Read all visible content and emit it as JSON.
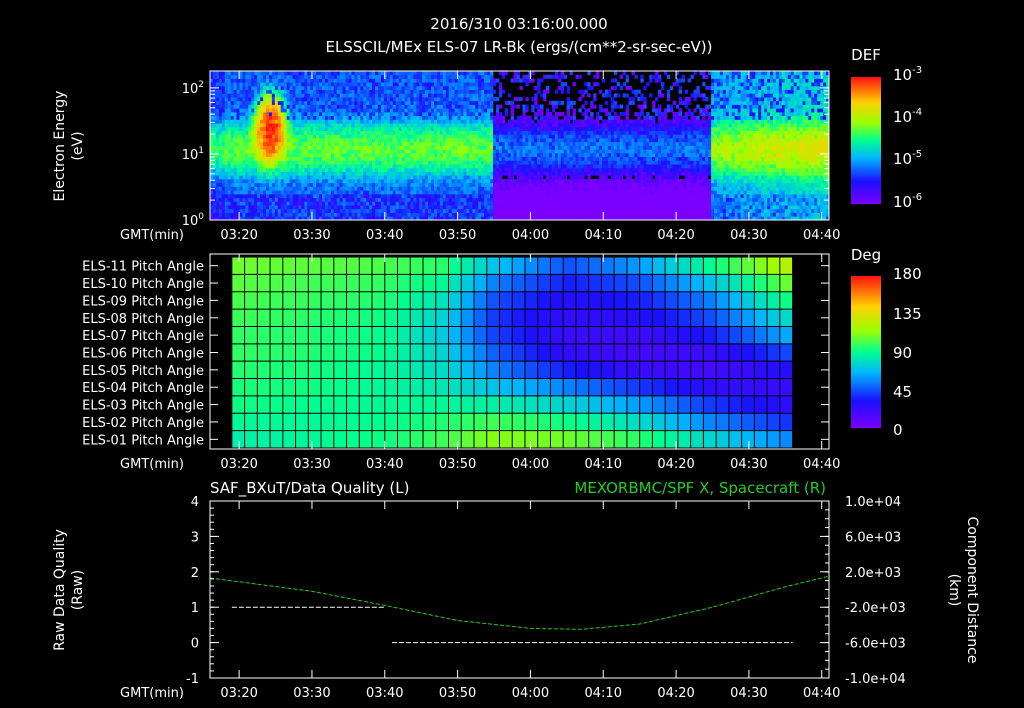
{
  "header": {
    "line1": "2016/310 03:16:00.000",
    "line2": "ELSSCIL/MEx ELS-07 LR-Bk  (ergs/(cm**2-sr-sec-eV))"
  },
  "time_axis": {
    "label": "GMT(min)",
    "ticks": [
      "03:20",
      "03:30",
      "03:40",
      "03:50",
      "04:00",
      "04:10",
      "04:20",
      "04:30",
      "04:40"
    ]
  },
  "chart_data": [
    {
      "type": "heatmap",
      "id": "electron-spectrogram",
      "title": "ELSSCIL/MEx ELS-07 LR-Bk  (ergs/(cm**2-sr-sec-eV))",
      "ylabel": "Electron Energy\n(eV)",
      "yscale": "log",
      "ylim": [
        1,
        180
      ],
      "y_ticks": [
        {
          "base": "10",
          "exp": "0",
          "value": 1
        },
        {
          "base": "10",
          "exp": "1",
          "value": 10
        },
        {
          "base": "10",
          "exp": "2",
          "value": 100
        }
      ],
      "xlim": [
        "03:16",
        "04:41"
      ],
      "colorbar": {
        "title": "DEF",
        "scale": "log",
        "ticks": [
          {
            "base": "10",
            "exp": "-3",
            "value": 0.001
          },
          {
            "base": "10",
            "exp": "-4",
            "value": 0.0001
          },
          {
            "base": "10",
            "exp": "-5",
            "value": 1e-05
          },
          {
            "base": "10",
            "exp": "-6",
            "value": 1e-06
          }
        ]
      },
      "features": [
        {
          "time": "03:24",
          "peak_energy_eV": 20,
          "level": "1e-3"
        },
        {
          "time_range": [
            "03:18",
            "03:55"
          ],
          "band_eV": [
            5,
            25
          ],
          "level": "3e-5"
        },
        {
          "time_range": [
            "03:55",
            "04:25"
          ],
          "band_eV": [
            5,
            25
          ],
          "level": "3e-6"
        },
        {
          "time_range": [
            "04:25",
            "04:41"
          ],
          "band_eV": [
            5,
            30
          ],
          "level": "8e-5"
        }
      ]
    },
    {
      "type": "heatmap",
      "id": "pitch-angle",
      "rows": [
        "ELS-11 Pitch Angle",
        "ELS-10 Pitch Angle",
        "ELS-09 Pitch Angle",
        "ELS-08 Pitch Angle",
        "ELS-07 Pitch Angle",
        "ELS-06 Pitch Angle",
        "ELS-05 Pitch Angle",
        "ELS-04 Pitch Angle",
        "ELS-03 Pitch Angle",
        "ELS-02 Pitch Angle",
        "ELS-01 Pitch Angle"
      ],
      "xlim": [
        "03:16",
        "04:41"
      ],
      "data_range": [
        "03:19",
        "04:36"
      ],
      "colorbar": {
        "title": "Deg",
        "range": [
          0,
          180
        ],
        "ticks": [
          "180",
          "135",
          "90",
          "45",
          "0"
        ]
      },
      "time_nodes": [
        "03:19",
        "03:30",
        "03:40",
        "03:48",
        "03:55",
        "04:05",
        "04:15",
        "04:25",
        "04:36"
      ],
      "values_deg": [
        [
          108,
          105,
          102,
          96,
          70,
          45,
          60,
          90,
          125
        ],
        [
          105,
          100,
          98,
          88,
          55,
          35,
          45,
          70,
          110
        ],
        [
          102,
          98,
          95,
          80,
          45,
          28,
          35,
          55,
          95
        ],
        [
          100,
          96,
          92,
          75,
          40,
          24,
          28,
          45,
          80
        ],
        [
          98,
          95,
          90,
          72,
          42,
          22,
          20,
          35,
          65
        ],
        [
          98,
          95,
          90,
          75,
          48,
          25,
          18,
          22,
          45
        ],
        [
          96,
          93,
          88,
          78,
          55,
          35,
          22,
          18,
          30
        ],
        [
          94,
          92,
          88,
          82,
          70,
          55,
          40,
          25,
          22
        ],
        [
          92,
          90,
          88,
          88,
          85,
          75,
          60,
          40,
          25
        ],
        [
          88,
          88,
          90,
          95,
          100,
          92,
          78,
          55,
          38
        ],
        [
          84,
          88,
          92,
          100,
          112,
          108,
          96,
          75,
          55
        ]
      ]
    },
    {
      "type": "line",
      "id": "quality-and-position",
      "title_left": "SAF_BXuT/Data Quality (L)",
      "title_right": "MEXORBMC/SPF X, Spacecraft (R)",
      "ylabel_left": "Raw Data Quality\n(Raw)",
      "ylabel_right": "Component Distance\n(km)",
      "ylim_left": [
        -1,
        4
      ],
      "y_ticks_left": [
        "-1",
        "0",
        "1",
        "2",
        "3",
        "4"
      ],
      "ylim_right": [
        -10000,
        10000
      ],
      "y_ticks_right": [
        "1.0e+04",
        "6.0e+03",
        "2.0e+03",
        "-2.0e+03",
        "-6.0e+03",
        "-1.0e+04"
      ],
      "series": [
        {
          "name": "Raw Data Quality",
          "axis": "left",
          "color": "#ffffff",
          "style": "dashed",
          "segments": [
            {
              "x": [
                "03:19",
                "03:40"
              ],
              "y": 1
            },
            {
              "x": [
                "03:41",
                "04:36"
              ],
              "y": 0
            }
          ]
        },
        {
          "name": "SPF X",
          "axis": "right",
          "color": "#22cc22",
          "style": "dashed",
          "x": [
            "03:16",
            "03:30",
            "03:40",
            "03:50",
            "04:00",
            "04:07",
            "04:15",
            "04:25",
            "04:35",
            "04:41"
          ],
          "y": [
            1300,
            -200,
            -1800,
            -3500,
            -4400,
            -4500,
            -3900,
            -2000,
            300,
            1500
          ]
        }
      ]
    }
  ],
  "colors": {
    "background": "#000000",
    "foreground": "#ffffff",
    "position_line": "#22cc22"
  }
}
